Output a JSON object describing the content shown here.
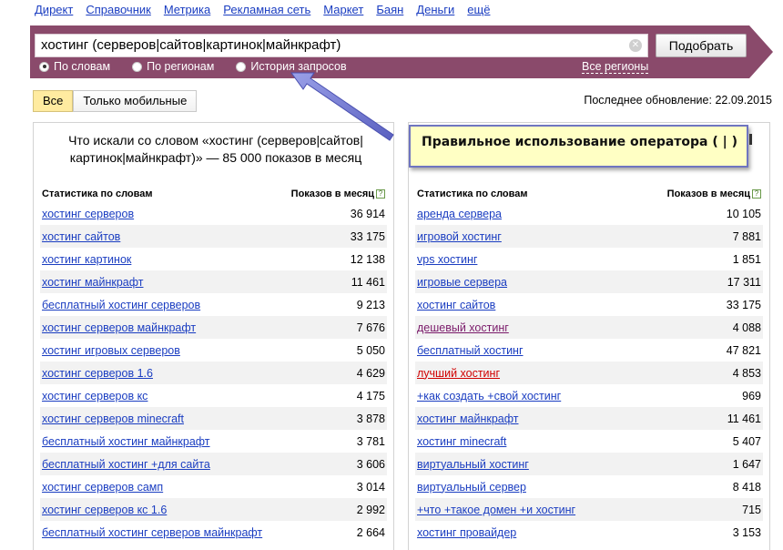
{
  "topnav": [
    "Директ",
    "Справочник",
    "Метрика",
    "Рекламная сеть",
    "Маркет",
    "Баян",
    "Деньги",
    "ещё"
  ],
  "search": {
    "value": "хостинг (серверов|сайтов|картинок|майнкрафт)",
    "clear_icon": "close-circle-icon",
    "submit_label": "Подобрать"
  },
  "modes": [
    {
      "label": "По словам",
      "selected": true
    },
    {
      "label": "По регионам",
      "selected": false
    },
    {
      "label": "История запросов",
      "selected": false
    }
  ],
  "regions_link": "Все регионы",
  "device_filter": {
    "all": "Все",
    "mobile": "Только мобильные",
    "selected": "all"
  },
  "updated": "Последнее обновление: 22.09.2015",
  "callout": "Правильное использование оператора ( | )",
  "left": {
    "title": "Что искали со словом «хостинг (серверов|сайтов|картинок|майнкрафт)» — 85 000 показов в месяц",
    "col_words": "Статистика по словам",
    "col_count": "Показов в месяц",
    "help_icon": "?",
    "rows": [
      {
        "q": "хостинг серверов",
        "n": "36 914"
      },
      {
        "q": "хостинг сайтов",
        "n": "33 175"
      },
      {
        "q": "хостинг картинок",
        "n": "12 138"
      },
      {
        "q": "хостинг майнкрафт",
        "n": "11 461"
      },
      {
        "q": "бесплатный хостинг серверов",
        "n": "9 213"
      },
      {
        "q": "хостинг серверов майнкрафт",
        "n": "7 676"
      },
      {
        "q": "хостинг игровых серверов",
        "n": "5 050"
      },
      {
        "q": "хостинг серверов 1.6",
        "n": "4 629"
      },
      {
        "q": "хостинг серверов кс",
        "n": "4 175"
      },
      {
        "q": "хостинг серверов minecraft",
        "n": "3 878"
      },
      {
        "q": "бесплатный хостинг майнкрафт",
        "n": "3 781"
      },
      {
        "q": "бесплатный хостинг +для сайта",
        "n": "3 606"
      },
      {
        "q": "хостинг серверов самп",
        "n": "3 014"
      },
      {
        "q": "хостинг серверов кс 1.6",
        "n": "2 992"
      },
      {
        "q": "бесплатный хостинг серверов майнкрафт",
        "n": "2 664"
      }
    ]
  },
  "right": {
    "col_words": "Статистика по словам",
    "col_count": "Показов в месяц",
    "help_icon": "?",
    "rows": [
      {
        "q": "аренда сервера",
        "n": "10 105",
        "style": ""
      },
      {
        "q": "игровой хостинг",
        "n": "7 881",
        "style": ""
      },
      {
        "q": "vps хостинг",
        "n": "1 851",
        "style": ""
      },
      {
        "q": "игровые сервера",
        "n": "17 311",
        "style": ""
      },
      {
        "q": "хостинг сайтов",
        "n": "33 175",
        "style": ""
      },
      {
        "q": "дешевый хостинг",
        "n": "4 088",
        "style": "visited"
      },
      {
        "q": "бесплатный хостинг",
        "n": "47 821",
        "style": ""
      },
      {
        "q": "лучший хостинг",
        "n": "4 853",
        "style": "red"
      },
      {
        "q": "+как создать +свой хостинг",
        "n": "969",
        "style": ""
      },
      {
        "q": "хостинг майнкрафт",
        "n": "11 461",
        "style": ""
      },
      {
        "q": "хостинг minecraft",
        "n": "5 407",
        "style": ""
      },
      {
        "q": "виртуальный хостинг",
        "n": "1 647",
        "style": ""
      },
      {
        "q": "виртуальный сервер",
        "n": "8 418",
        "style": ""
      },
      {
        "q": "+что +такое домен +и хостинг",
        "n": "715",
        "style": ""
      },
      {
        "q": "хостинг провайдер",
        "n": "3 153",
        "style": ""
      }
    ]
  },
  "colors": {
    "banner": "#8a4a6b",
    "link": "#1a3dc1",
    "visited": "#7a1a6a",
    "red": "#d00000",
    "callout_bg": "#ffffc4",
    "callout_border": "#6f75c0",
    "active_tab": "#ffeba0"
  }
}
